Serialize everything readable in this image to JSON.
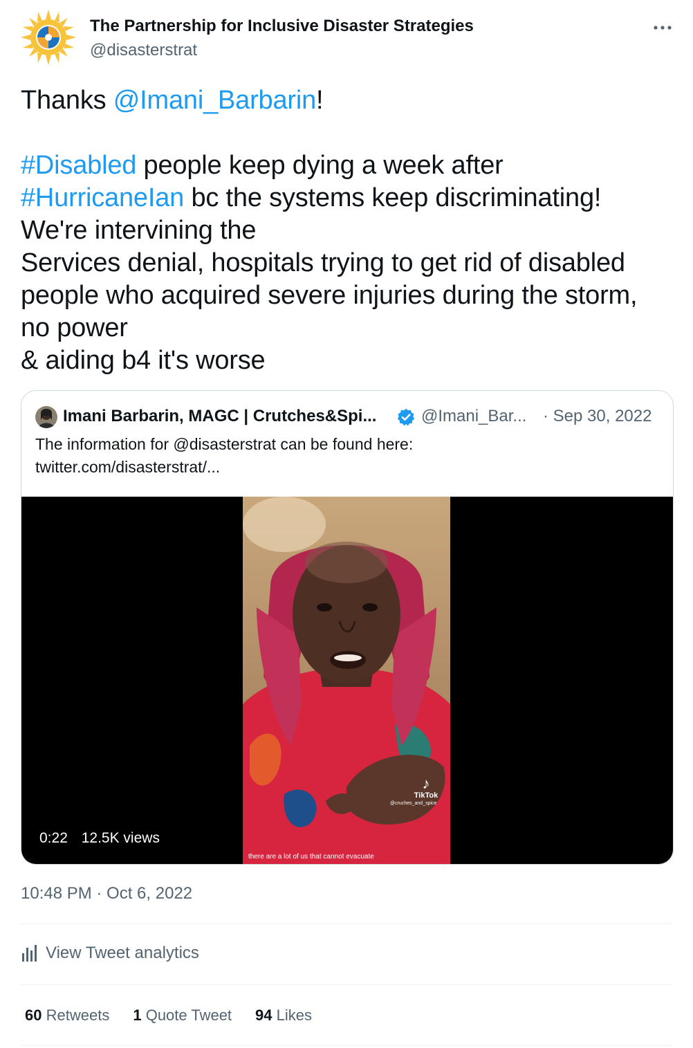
{
  "author": {
    "name": "The Partnership for Inclusive Disaster Strategies",
    "handle": "@disasterstrat",
    "avatar_icon": "sun-logo-icon",
    "avatar_colors": {
      "sun": "#f7c33a",
      "ring": "#ffffff",
      "quadrant": "#1e73be"
    }
  },
  "more_icon": "ellipsis-icon",
  "tweet": {
    "thanks": "Thanks ",
    "mention": "@Imani_Barbarin",
    "thanks_end": "!",
    "hashtag_disabled": "#Disabled",
    "line2_rest": " people keep dying a week after",
    "hashtag_hurricane": "#HurricaneIan",
    "line3_rest": " bc the systems keep discriminating!",
    "line4": "We're intervining the",
    "line5": "Services denial, hospitals trying to get rid of disabled",
    "line6": "people who acquired severe injuries during the storm,",
    "line7": "no power",
    "line8": "& aiding b4 it's worse"
  },
  "quote": {
    "name": "Imani Barbarin, MAGC | Crutches&Spi...",
    "handle": "@Imani_Bar...",
    "date": "· Sep 30, 2022",
    "verified_icon": "verified-badge-icon",
    "text_line1": "The information for @disasterstrat can be found here:",
    "text_line2": "twitter.com/disasterstrat/...",
    "video": {
      "duration": "0:22",
      "views": "12.5K views",
      "watermark": "TikTok",
      "watermark_user": "@cruches_and_spice",
      "caption": "there are a lot of us that cannot evacuate"
    }
  },
  "timestamp": "10:48 PM · Oct 6, 2022",
  "analytics": {
    "icon": "analytics-bars-icon",
    "label": "View Tweet analytics"
  },
  "stats": {
    "retweets_count": "60",
    "retweets_label": "Retweets",
    "quotes_count": "1",
    "quotes_label": "Quote Tweet",
    "likes_count": "94",
    "likes_label": "Likes"
  },
  "colors": {
    "link": "#1d9bf0",
    "secondary_text": "#536471",
    "primary_text": "#0f1419",
    "border": "#cfd9de"
  }
}
